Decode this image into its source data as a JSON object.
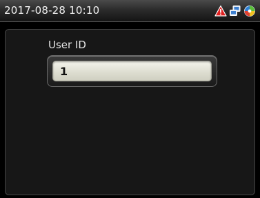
{
  "status_bar": {
    "datetime": "2017-08-28 10:10",
    "icons": [
      "alert-triangle-icon",
      "network-icon",
      "app-icon"
    ]
  },
  "form": {
    "field_label": "User ID",
    "field_value": "1"
  },
  "colors": {
    "background": "#000000",
    "panel": "#171717",
    "input_fill": "#e4e4d8",
    "alert_red": "#e02020"
  }
}
